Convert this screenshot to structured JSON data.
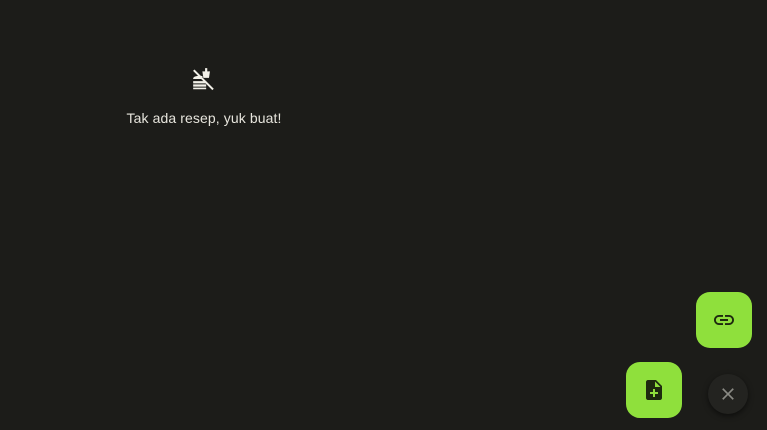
{
  "empty_state": {
    "icon": "no-food-icon",
    "message": "Tak ada resep, yuk buat!"
  },
  "fab_actions": [
    {
      "icon": "link-icon"
    },
    {
      "icon": "new-document-icon"
    }
  ],
  "close_button": {
    "icon": "close-icon"
  },
  "colors": {
    "background": "#1c1c19",
    "accent": "#8fe03c",
    "text": "#e6e4dc",
    "icon_dark": "#1e2a0f"
  }
}
